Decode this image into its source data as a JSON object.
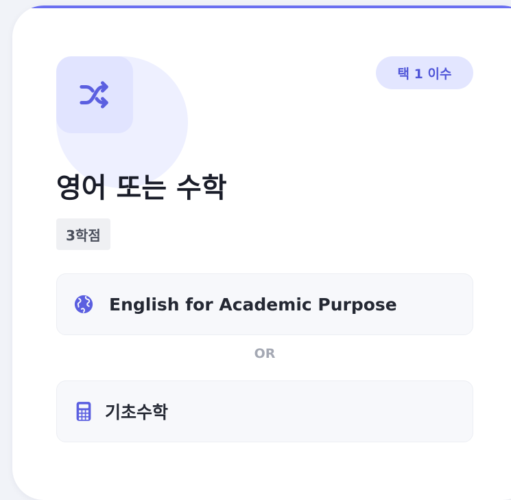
{
  "card": {
    "accent_color": "#6a6ff0",
    "icon": "shuffle-icon",
    "badge": "택 1 이수",
    "title": "영어 또는 수학",
    "credits": "3학점"
  },
  "options": [
    {
      "icon": "globe-icon",
      "label": "English for Academic Purpose"
    },
    {
      "icon": "calculator-icon",
      "label": "기초수학"
    }
  ],
  "separator": "OR"
}
